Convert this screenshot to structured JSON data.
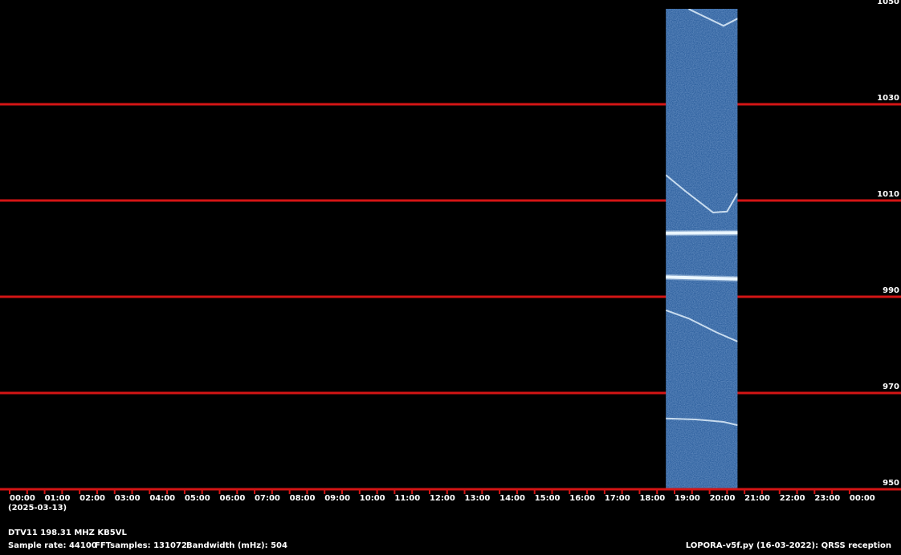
{
  "chart_data": {
    "type": "heatmap",
    "ylim": [
      950,
      1050
    ],
    "y_ticks": [
      950,
      970,
      990,
      1010,
      1030,
      1050
    ],
    "x_ticks": [
      "00:00",
      "01:00",
      "02:00",
      "03:00",
      "04:00",
      "05:00",
      "06:00",
      "07:00",
      "08:00",
      "09:00",
      "10:00",
      "11:00",
      "12:00",
      "13:00",
      "14:00",
      "15:00",
      "16:00",
      "17:00",
      "18:00",
      "19:00",
      "20:00",
      "21:00",
      "22:00",
      "23:00",
      "00:00"
    ],
    "date_label": "(2025-03-13)",
    "grid": true,
    "data_window": {
      "start_hour": 18.75,
      "end_hour": 20.8
    },
    "traces": [
      {
        "kind": "strong",
        "points": [
          [
            18.75,
            1003.2
          ],
          [
            20.8,
            1003.3
          ]
        ]
      },
      {
        "kind": "strong",
        "points": [
          [
            18.75,
            994.1
          ],
          [
            20.8,
            993.7
          ]
        ]
      },
      {
        "kind": "faint",
        "points": [
          [
            18.75,
            987.2
          ],
          [
            19.4,
            985.5
          ],
          [
            20.2,
            982.6
          ],
          [
            20.8,
            980.7
          ]
        ]
      },
      {
        "kind": "faint",
        "points": [
          [
            18.75,
            964.7
          ],
          [
            19.6,
            964.5
          ],
          [
            20.4,
            964.0
          ],
          [
            20.8,
            963.3
          ]
        ]
      },
      {
        "kind": "faint",
        "points": [
          [
            19.4,
            1049.8
          ],
          [
            20.4,
            1046.3
          ],
          [
            20.8,
            1047.8
          ]
        ]
      },
      {
        "kind": "faint",
        "points": [
          [
            18.75,
            1015.3
          ],
          [
            19.3,
            1012.0
          ],
          [
            20.1,
            1007.5
          ],
          [
            20.5,
            1007.7
          ],
          [
            20.8,
            1011.5
          ]
        ]
      }
    ],
    "colors": {
      "background": "#000000",
      "grid_line": "#d41515",
      "waterfall": "#2c5f9d",
      "trace": "#eaf6ff"
    }
  },
  "footer": {
    "station": "DTV11 198.31 MHZ KB5VL",
    "sample_rate": "Sample rate: 44100",
    "fft_samples": "FFTsamples: 131072",
    "bandwidth": "Bandwidth (mHz): 504",
    "software": "LOPORA-v5f.py (16-03-2022): QRSS reception"
  }
}
